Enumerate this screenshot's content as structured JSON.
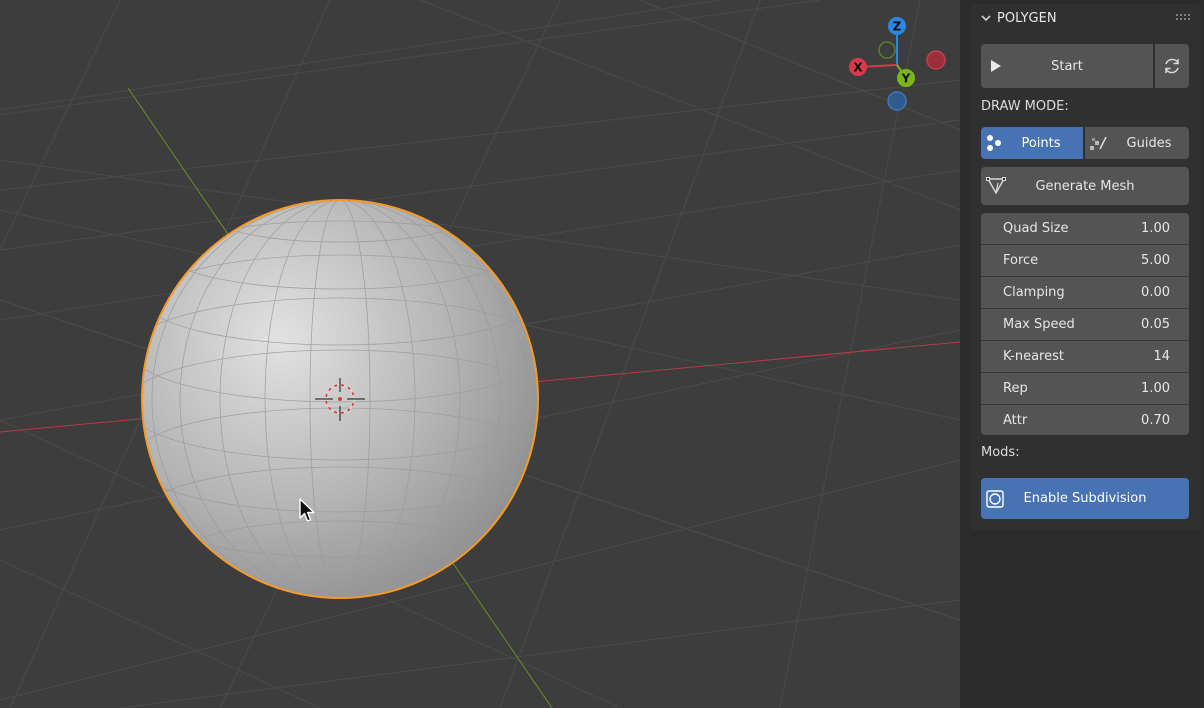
{
  "panel": {
    "title": "POLYGEN",
    "start_label": "Start",
    "draw_mode_label": "DRAW MODE:",
    "modes": [
      {
        "label": "Points",
        "active": true
      },
      {
        "label": "Guides",
        "active": false
      }
    ],
    "generate_label": "Generate Mesh",
    "properties": [
      {
        "label": "Quad Size",
        "value": "1.00"
      },
      {
        "label": "Force",
        "value": "5.00"
      },
      {
        "label": "Clamping",
        "value": "0.00"
      },
      {
        "label": "Max Speed",
        "value": "0.05"
      },
      {
        "label": "K-nearest",
        "value": "14"
      },
      {
        "label": "Rep",
        "value": "1.00"
      },
      {
        "label": "Attr",
        "value": "0.70"
      }
    ],
    "mods_label": "Mods:",
    "subdivision_label": "Enable Subdivision"
  },
  "gizmo": {
    "z_label": "Z",
    "x_label": "X",
    "y_label": "Y"
  },
  "colors": {
    "accent": "#4772b3",
    "selection_outline": "#f39a2b",
    "axis_x": "#d83a4b",
    "axis_y": "#7ab619",
    "axis_z": "#2c86e0"
  },
  "icons": [
    "chevron-down-icon",
    "grip-icon",
    "play-icon",
    "refresh-icon",
    "points-icon",
    "guides-icon",
    "mesh-icon",
    "checkbox-icon",
    "mouse-pointer-icon",
    "3d-cursor-icon"
  ]
}
